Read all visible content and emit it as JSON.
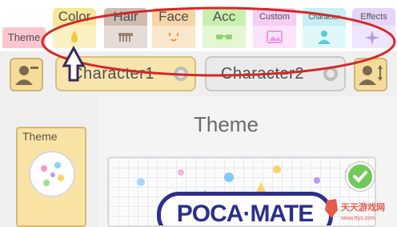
{
  "tabs": [
    {
      "label": "Color",
      "icon": "droplet-icon",
      "bg": "#f8e79a",
      "body": "#fbf0c2"
    },
    {
      "label": "Hair",
      "icon": "comb-icon",
      "bg": "#cdbcb1",
      "body": "#e6dcd5"
    },
    {
      "label": "Face",
      "icon": "face-icon",
      "bg": "#f7d4a6",
      "body": "#fbe7cc"
    },
    {
      "label": "Acc",
      "icon": "sunglasses-icon",
      "bg": "#c9efae",
      "body": "#e2f7d2"
    },
    {
      "label": "Custom",
      "icon": "image-icon",
      "bg": "#f7cdf3",
      "body": "#fbe3f9"
    },
    {
      "label": "Character",
      "icon": "person-icon",
      "bg": "#c8eef4",
      "body": "#e0f7fa"
    },
    {
      "label": "Effects",
      "icon": "sparkle-icon",
      "bg": "#e4d6fb",
      "body": "#efe6fd"
    }
  ],
  "theme_tab": {
    "label": "Theme",
    "bg": "#f9c6cf"
  },
  "toolbar": {
    "character1_label": "Character1",
    "character2_label": "Character2"
  },
  "content": {
    "section_title": "Theme",
    "theme_card_label": "Theme",
    "preview_logo_text": "POCA·MATE"
  },
  "watermark": {
    "text": "天天游戏网",
    "sub": "www.ttyx.com"
  },
  "colors": {
    "annotation_ellipse": "#d42828",
    "cursor": "#3a2a55",
    "check_green": "#72c95a"
  }
}
